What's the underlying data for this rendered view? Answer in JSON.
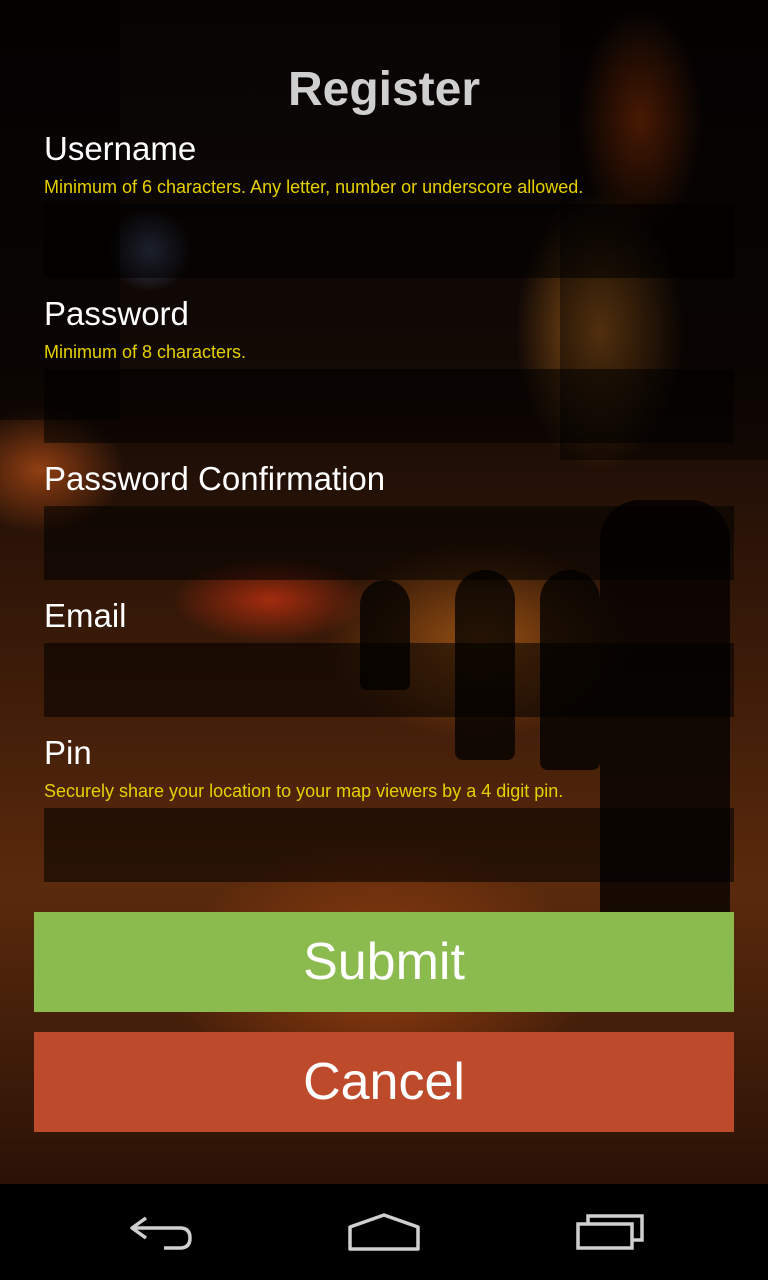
{
  "app": {
    "title": "Register"
  },
  "fields": [
    {
      "label": "Username",
      "hint": "Minimum of 6 characters. Any letter, number or underscore allowed.",
      "value": ""
    },
    {
      "label": "Password",
      "hint": "Minimum of 8 characters.",
      "value": ""
    },
    {
      "label": "Password Confirmation",
      "hint": "",
      "value": ""
    },
    {
      "label": "Email",
      "hint": "",
      "value": ""
    },
    {
      "label": "Pin",
      "hint": "Securely share your location to your map viewers by a 4 digit pin.",
      "value": ""
    }
  ],
  "buttons": {
    "submit": "Submit",
    "cancel": "Cancel"
  },
  "navbar": {
    "icons": [
      "back-icon",
      "home-icon",
      "recent-apps-icon"
    ]
  },
  "colors": {
    "submit": "#8bba4e",
    "cancel": "#bd4a2b",
    "hint": "#e6d000",
    "title": "#cfcfcf"
  }
}
